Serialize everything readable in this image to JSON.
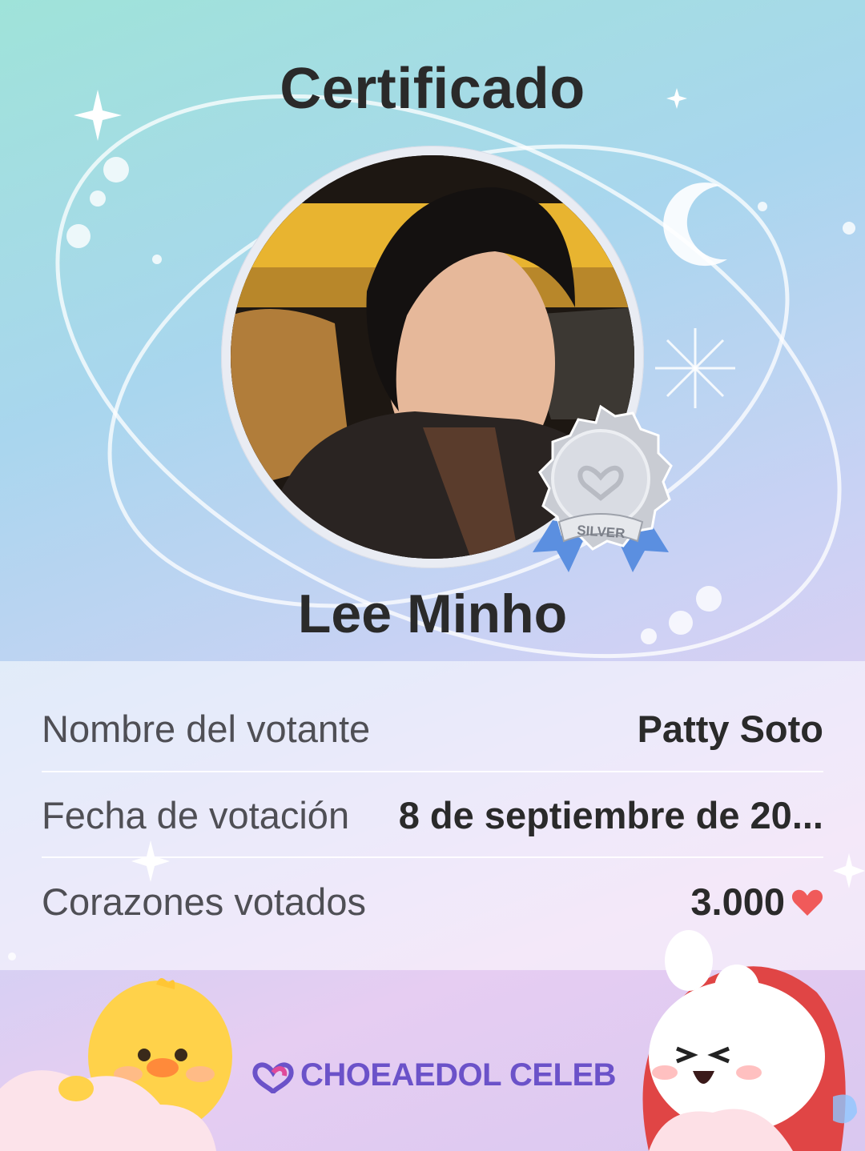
{
  "certificate": {
    "title": "Certificado",
    "celebrity_name": "Lee Minho",
    "badge_label": "SILVER",
    "rows": [
      {
        "label": "Nombre del votante",
        "value": "Patty Soto"
      },
      {
        "label": "Fecha de votación",
        "value": "8 de septiembre de 20..."
      },
      {
        "label": "Corazones votados",
        "value": "3.000"
      }
    ]
  },
  "brand": {
    "name": "CHOEAEDOL CELEB"
  },
  "icons": {
    "heart": "heart-icon",
    "badge": "silver-medal-icon",
    "logo": "choeaedol-logo-icon",
    "moon": "crescent-moon-icon",
    "sparkle": "sparkle-icon"
  },
  "colors": {
    "heart": "#f05a5a",
    "brand": "#6b52c9",
    "badge_ribbon": "#5b8fe0",
    "badge_silver": "#c9ccd3"
  }
}
